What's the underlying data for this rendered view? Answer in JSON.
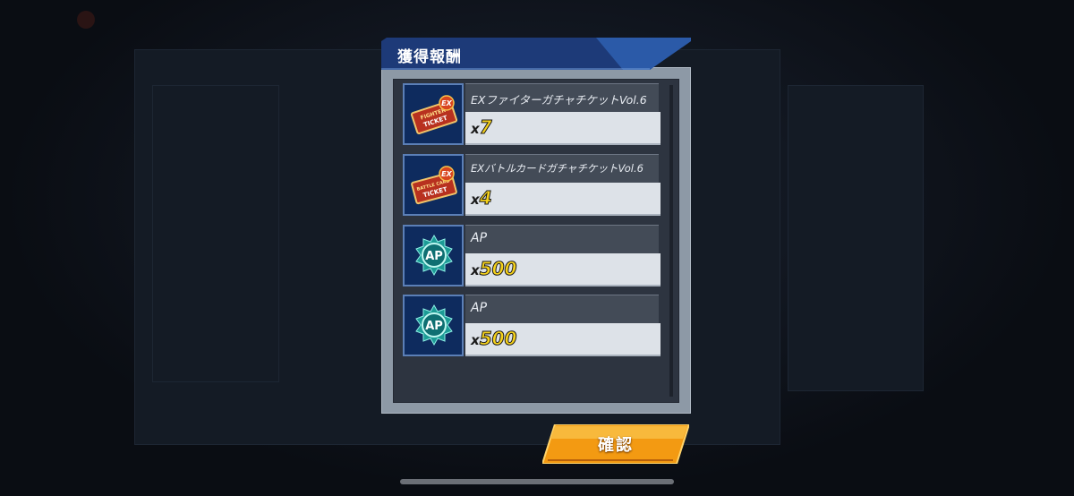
{
  "dialog": {
    "title": "獲得報酬",
    "rewards": [
      {
        "name": "EXファイターガチャチケットVol.6",
        "qty_prefix": "x",
        "qty": "7",
        "icon": "fighter-ticket-icon"
      },
      {
        "name": "EXバトルカードガチャチケットVol.6",
        "qty_prefix": "x",
        "qty": "4",
        "icon": "battle-card-ticket-icon"
      },
      {
        "name": "AP",
        "qty_prefix": "x",
        "qty": "500",
        "icon": "ap-medal-icon"
      },
      {
        "name": "AP",
        "qty_prefix": "x",
        "qty": "500",
        "icon": "ap-medal-icon"
      }
    ],
    "icon_text": {
      "ticket_ex": "EX",
      "fighter_ticket_line1": "FIGHTER",
      "fighter_ticket_line2": "TICKET",
      "battle_ticket_line1": "BATTLE CARD",
      "battle_ticket_line2": "TICKET",
      "ap": "AP"
    }
  },
  "confirm_button": {
    "label": "確認"
  },
  "colors": {
    "header_blue": "#1d3a78",
    "qty_yellow": "#f6d21b",
    "button_orange": "#f39a12"
  }
}
